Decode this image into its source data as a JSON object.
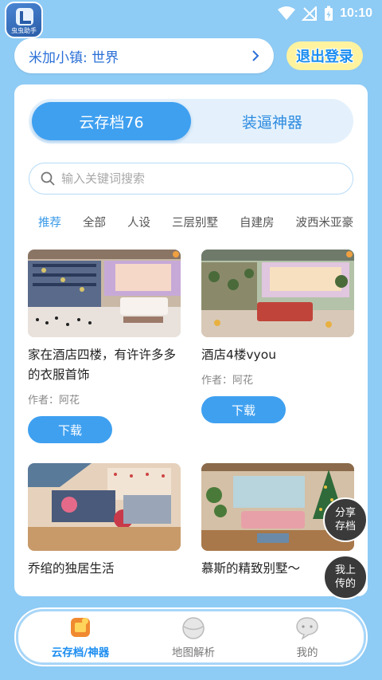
{
  "status_bar": {
    "time": "10:10",
    "app_badge_label": "虫虫助手"
  },
  "header": {
    "world_label": "米加小镇: 世界",
    "logout_label": "退出登录"
  },
  "tabs": [
    {
      "label": "云存档76",
      "active": true
    },
    {
      "label": "装逼神器",
      "active": false
    }
  ],
  "search": {
    "placeholder": "输入关键词搜索",
    "value": ""
  },
  "categories": [
    "推荐",
    "全部",
    "人设",
    "三层别墅",
    "自建房",
    "波西米亚豪"
  ],
  "active_category": "推荐",
  "posts": [
    {
      "title": "家在酒店四楼，有许许多多的衣服首饰",
      "author": "作者：阿花",
      "download_label": "下载"
    },
    {
      "title": "酒店4楼vyou",
      "author": "作者：阿花",
      "download_label": "下载"
    },
    {
      "title": "乔绾的独居生活"
    },
    {
      "title": "慕斯的精致别墅～"
    }
  ],
  "floating": {
    "share_label": "分享存档",
    "uploads_label": "我上传的"
  },
  "bottom_nav": [
    {
      "label": "云存档/神器",
      "icon": "cloud-save-icon",
      "active": true
    },
    {
      "label": "地图解析",
      "icon": "map-globe-icon",
      "active": false
    },
    {
      "label": "我的",
      "icon": "profile-chat-icon",
      "active": false
    }
  ],
  "colors": {
    "background": "#8ecbf5",
    "accent": "#3fa0f0",
    "tab_track": "#e4f1fc",
    "logout_bg": "#fff3a0"
  }
}
